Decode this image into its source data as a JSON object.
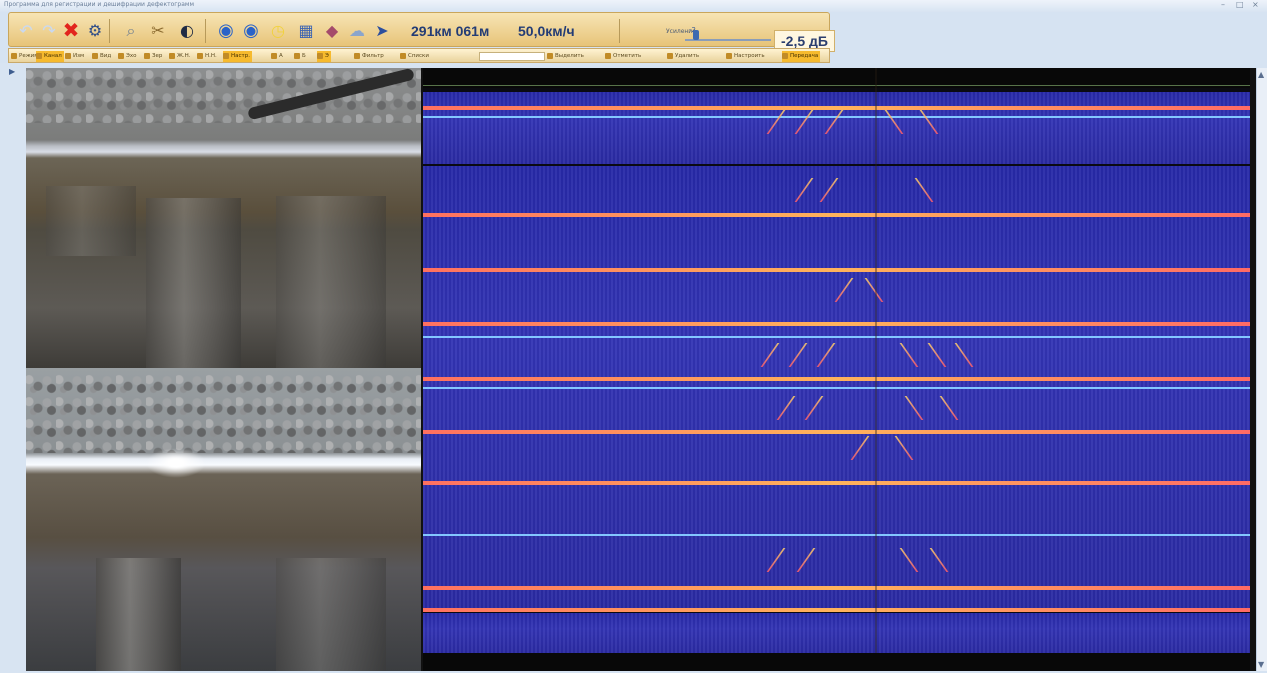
{
  "window": {
    "title": "Программа для регистрации и дешифрации дефектограмм"
  },
  "toolbar": {
    "icons": [
      "undo-icon",
      "redo-icon",
      "close-red-icon",
      "settings-icon",
      "view-icon",
      "tools-icon",
      "contrast-icon",
      "back-icon",
      "forward-icon",
      "timer-icon",
      "folder-icon",
      "archive-icon",
      "cloud-icon",
      "export-icon"
    ],
    "position": "291км 061м",
    "speed": "50,0км/ч",
    "slider_label": "Усиление",
    "slider_value": "-2",
    "gain": "-2,5 дБ"
  },
  "secondary_toolbar": {
    "items": [
      "Режим",
      "Канал",
      "Изм",
      "Вид",
      "Эхо",
      "Зер",
      "Ж.Н.",
      "Н.Н.",
      "Настр.",
      "А",
      "Б",
      "Э",
      "Фильтр",
      "Списки",
      "Выделить",
      "Отметить",
      "Удалить",
      "Настроить",
      "Передача"
    ],
    "active": [
      "Канал",
      "Настр.",
      "Э",
      "Передача"
    ]
  },
  "layout": {
    "scroll_up": "▲",
    "scroll_down": "▼",
    "nav_arrow": "▶"
  },
  "colors": {
    "toolbar": "#e7c478",
    "readout": "#233c75",
    "scan_bg": "#2a2aa2",
    "stripe": "#ff7060"
  }
}
